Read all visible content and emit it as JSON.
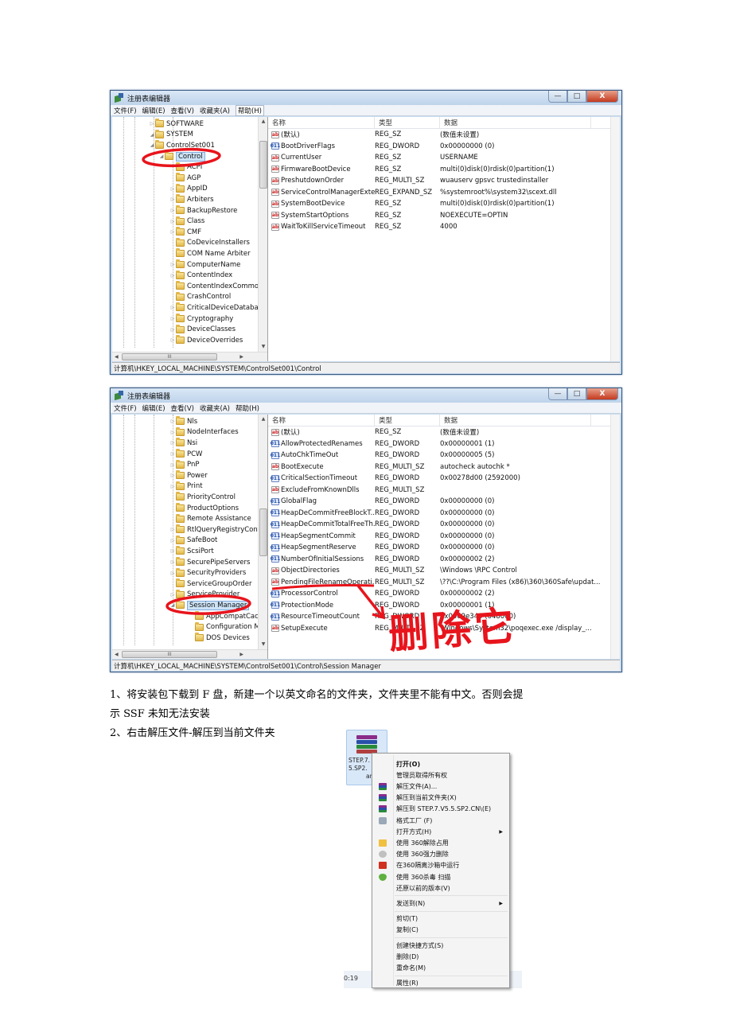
{
  "window1": {
    "title": "注册表编辑器",
    "menu": [
      "文件(F)",
      "编辑(E)",
      "查看(V)",
      "收藏夹(A)",
      "帮助(H)"
    ],
    "window_buttons": {
      "minimize": "—",
      "maximize": "□",
      "close": "X"
    },
    "tree": [
      {
        "label": "SOFTWARE",
        "level": 0,
        "expander": "collapsed"
      },
      {
        "label": "SYSTEM",
        "level": 0,
        "expander": "expanded"
      },
      {
        "label": "ControlSet001",
        "level": 1,
        "expander": "expanded"
      },
      {
        "label": "Control",
        "level": 2,
        "expander": "expanded",
        "selected": true
      },
      {
        "label": "ACPI",
        "level": 3,
        "expander": "none"
      },
      {
        "label": "AGP",
        "level": 3,
        "expander": "none"
      },
      {
        "label": "AppID",
        "level": 3,
        "expander": "collapsed"
      },
      {
        "label": "Arbiters",
        "level": 3,
        "expander": "collapsed"
      },
      {
        "label": "BackupRestore",
        "level": 3,
        "expander": "collapsed"
      },
      {
        "label": "Class",
        "level": 3,
        "expander": "collapsed"
      },
      {
        "label": "CMF",
        "level": 3,
        "expander": "collapsed"
      },
      {
        "label": "CoDeviceInstallers",
        "level": 3,
        "expander": "none"
      },
      {
        "label": "COM Name Arbiter",
        "level": 3,
        "expander": "none"
      },
      {
        "label": "ComputerName",
        "level": 3,
        "expander": "collapsed"
      },
      {
        "label": "ContentIndex",
        "level": 3,
        "expander": "collapsed"
      },
      {
        "label": "ContentIndexCommon",
        "level": 3,
        "expander": "none"
      },
      {
        "label": "CrashControl",
        "level": 3,
        "expander": "none"
      },
      {
        "label": "CriticalDeviceDatabase",
        "level": 3,
        "expander": "collapsed"
      },
      {
        "label": "Cryptography",
        "level": 3,
        "expander": "collapsed"
      },
      {
        "label": "DeviceClasses",
        "level": 3,
        "expander": "collapsed"
      },
      {
        "label": "DeviceOverrides",
        "level": 3,
        "expander": "collapsed"
      }
    ],
    "columns": [
      "名称",
      "类型",
      "数据"
    ],
    "values": [
      {
        "icon": "ab",
        "name": "(默认)",
        "type": "REG_SZ",
        "data": "(数值未设置)"
      },
      {
        "icon": "dw",
        "name": "BootDriverFlags",
        "type": "REG_DWORD",
        "data": "0x00000000 (0)"
      },
      {
        "icon": "ab",
        "name": "CurrentUser",
        "type": "REG_SZ",
        "data": "USERNAME"
      },
      {
        "icon": "ab",
        "name": "FirmwareBootDevice",
        "type": "REG_SZ",
        "data": "multi(0)disk(0)rdisk(0)partition(1)"
      },
      {
        "icon": "ab",
        "name": "PreshutdownOrder",
        "type": "REG_MULTI_SZ",
        "data": "wuauserv gpsvc trustedinstaller"
      },
      {
        "icon": "ab",
        "name": "ServiceControlManagerExte...",
        "type": "REG_EXPAND_SZ",
        "data": "%systemroot%\\system32\\scext.dll"
      },
      {
        "icon": "ab",
        "name": "SystemBootDevice",
        "type": "REG_SZ",
        "data": "multi(0)disk(0)rdisk(0)partition(1)"
      },
      {
        "icon": "ab",
        "name": "SystemStartOptions",
        "type": "REG_SZ",
        "data": " NOEXECUTE=OPTIN"
      },
      {
        "icon": "ab",
        "name": "WaitToKillServiceTimeout",
        "type": "REG_SZ",
        "data": "4000"
      }
    ],
    "statusbar": "计算机\\HKEY_LOCAL_MACHINE\\SYSTEM\\ControlSet001\\Control",
    "hscroll_grip": "III"
  },
  "window2": {
    "title": "注册表编辑器",
    "menu": [
      "文件(F)",
      "编辑(E)",
      "查看(V)",
      "收藏夹(A)",
      "帮助(H)"
    ],
    "window_buttons": {
      "minimize": "—",
      "maximize": "□",
      "close": "X"
    },
    "tree": [
      {
        "label": "Nls",
        "level": 3,
        "expander": "collapsed"
      },
      {
        "label": "NodeInterfaces",
        "level": 3,
        "expander": "collapsed"
      },
      {
        "label": "Nsi",
        "level": 3,
        "expander": "collapsed"
      },
      {
        "label": "PCW",
        "level": 3,
        "expander": "collapsed"
      },
      {
        "label": "PnP",
        "level": 3,
        "expander": "collapsed"
      },
      {
        "label": "Power",
        "level": 3,
        "expander": "collapsed"
      },
      {
        "label": "Print",
        "level": 3,
        "expander": "collapsed"
      },
      {
        "label": "PriorityControl",
        "level": 3,
        "expander": "none"
      },
      {
        "label": "ProductOptions",
        "level": 3,
        "expander": "none"
      },
      {
        "label": "Remote Assistance",
        "level": 3,
        "expander": "none"
      },
      {
        "label": "RtlQueryRegistryConfig",
        "level": 3,
        "expander": "collapsed"
      },
      {
        "label": "SafeBoot",
        "level": 3,
        "expander": "collapsed"
      },
      {
        "label": "ScsiPort",
        "level": 3,
        "expander": "collapsed"
      },
      {
        "label": "SecurePipeServers",
        "level": 3,
        "expander": "collapsed"
      },
      {
        "label": "SecurityProviders",
        "level": 3,
        "expander": "collapsed"
      },
      {
        "label": "ServiceGroupOrder",
        "level": 3,
        "expander": "none"
      },
      {
        "label": "ServiceProvider",
        "level": 3,
        "expander": "collapsed"
      },
      {
        "label": "Session Manager",
        "level": 3,
        "expander": "expanded",
        "selected": true
      },
      {
        "label": "AppCompatCache",
        "level": 4,
        "expander": "none"
      },
      {
        "label": "Configuration Manager",
        "level": 4,
        "expander": "none"
      },
      {
        "label": "DOS Devices",
        "level": 4,
        "expander": "none"
      }
    ],
    "columns": [
      "名称",
      "类型",
      "数据"
    ],
    "values": [
      {
        "icon": "ab",
        "name": "(默认)",
        "type": "REG_SZ",
        "data": "(数值未设置)"
      },
      {
        "icon": "dw",
        "name": "AllowProtectedRenames",
        "type": "REG_DWORD",
        "data": "0x00000001 (1)"
      },
      {
        "icon": "dw",
        "name": "AutoChkTimeOut",
        "type": "REG_DWORD",
        "data": "0x00000005 (5)"
      },
      {
        "icon": "ab",
        "name": "BootExecute",
        "type": "REG_MULTI_SZ",
        "data": "autocheck autochk *"
      },
      {
        "icon": "dw",
        "name": "CriticalSectionTimeout",
        "type": "REG_DWORD",
        "data": "0x00278d00 (2592000)"
      },
      {
        "icon": "ab",
        "name": "ExcludeFromKnownDlls",
        "type": "REG_MULTI_SZ",
        "data": ""
      },
      {
        "icon": "dw",
        "name": "GlobalFlag",
        "type": "REG_DWORD",
        "data": "0x00000000 (0)"
      },
      {
        "icon": "dw",
        "name": "HeapDeCommitFreeBlockT...",
        "type": "REG_DWORD",
        "data": "0x00000000 (0)"
      },
      {
        "icon": "dw",
        "name": "HeapDeCommitTotalFreeTh...",
        "type": "REG_DWORD",
        "data": "0x00000000 (0)"
      },
      {
        "icon": "dw",
        "name": "HeapSegmentCommit",
        "type": "REG_DWORD",
        "data": "0x00000000 (0)"
      },
      {
        "icon": "dw",
        "name": "HeapSegmentReserve",
        "type": "REG_DWORD",
        "data": "0x00000000 (0)"
      },
      {
        "icon": "dw",
        "name": "NumberOfInitialSessions",
        "type": "REG_DWORD",
        "data": "0x00000002 (2)"
      },
      {
        "icon": "ab",
        "name": "ObjectDirectories",
        "type": "REG_MULTI_SZ",
        "data": "\\Windows \\RPC Control"
      },
      {
        "icon": "ab",
        "name": "PendingFileRenameOperati...",
        "type": "REG_MULTI_SZ",
        "data": "\\??\\C:\\Program Files (x86)\\360\\360Safe\\updat..."
      },
      {
        "icon": "dw",
        "name": "ProcessorControl",
        "type": "REG_DWORD",
        "data": "0x00000002 (2)"
      },
      {
        "icon": "dw",
        "name": "ProtectionMode",
        "type": "REG_DWORD",
        "data": "0x00000001 (1)"
      },
      {
        "icon": "dw",
        "name": "ResourceTimeoutCount",
        "type": "REG_DWORD",
        "data": "0x0009e340 (648000)"
      },
      {
        "icon": "ab",
        "name": "SetupExecute",
        "type": "REG_MULTI_SZ",
        "data": "\\Windows\\System32\\poqexec.exe /display_..."
      }
    ],
    "statusbar": "计算机\\HKEY_LOCAL_MACHINE\\SYSTEM\\ControlSet001\\Control\\Session Manager",
    "annotation": "删除它",
    "hscroll_grip": "III"
  },
  "instructions": {
    "step1_line1": "1、将安装包下载到 F 盘，新建一个以英文命名的文件夹，文件夹里不能有中文。否则会提",
    "step1_line2": "示 SSF 未知无法安装",
    "step2": "2、右击解压文件-解压到当前文件夹"
  },
  "context_screenshot": {
    "file_name_lines": [
      "STEP.7.",
      "5.SP2.",
      "ar"
    ],
    "time": "0:19",
    "menu_items": [
      {
        "label": "打开(O)",
        "icon": "",
        "bold": true
      },
      {
        "label": "管理员取得所有权",
        "icon": ""
      },
      {
        "label": "解压文件(A)...",
        "icon": "winrar"
      },
      {
        "label": "解压到当前文件夹(X)",
        "icon": "winrar"
      },
      {
        "label": "解压到 STEP.7.V5.5.SP2.CN\\(E)",
        "icon": "winrar"
      },
      {
        "label": "格式工厂 (F)",
        "icon": "format-factory"
      },
      {
        "label": "打开方式(H)",
        "icon": "",
        "submenu": true
      },
      {
        "label": "使用 360解除占用",
        "icon": "360-unlock"
      },
      {
        "label": "使用 360强力删除",
        "icon": "360-delete"
      },
      {
        "label": "在360隔离沙箱中运行",
        "icon": "360-sandbox"
      },
      {
        "label": "使用 360杀毒 扫描",
        "icon": "360-antivirus"
      },
      {
        "label": "还原以前的版本(V)",
        "icon": ""
      },
      {
        "sep": true
      },
      {
        "label": "发送到(N)",
        "icon": "",
        "submenu": true
      },
      {
        "sep": true
      },
      {
        "label": "剪切(T)",
        "icon": ""
      },
      {
        "label": "复制(C)",
        "icon": ""
      },
      {
        "sep": true
      },
      {
        "label": "创建快捷方式(S)",
        "icon": ""
      },
      {
        "label": "删除(D)",
        "icon": ""
      },
      {
        "label": "重命名(M)",
        "icon": ""
      },
      {
        "sep": true
      },
      {
        "label": "属性(R)",
        "icon": ""
      }
    ]
  },
  "colors": {
    "annotation_red": "#e8141c",
    "selection": "#cde4f7"
  }
}
